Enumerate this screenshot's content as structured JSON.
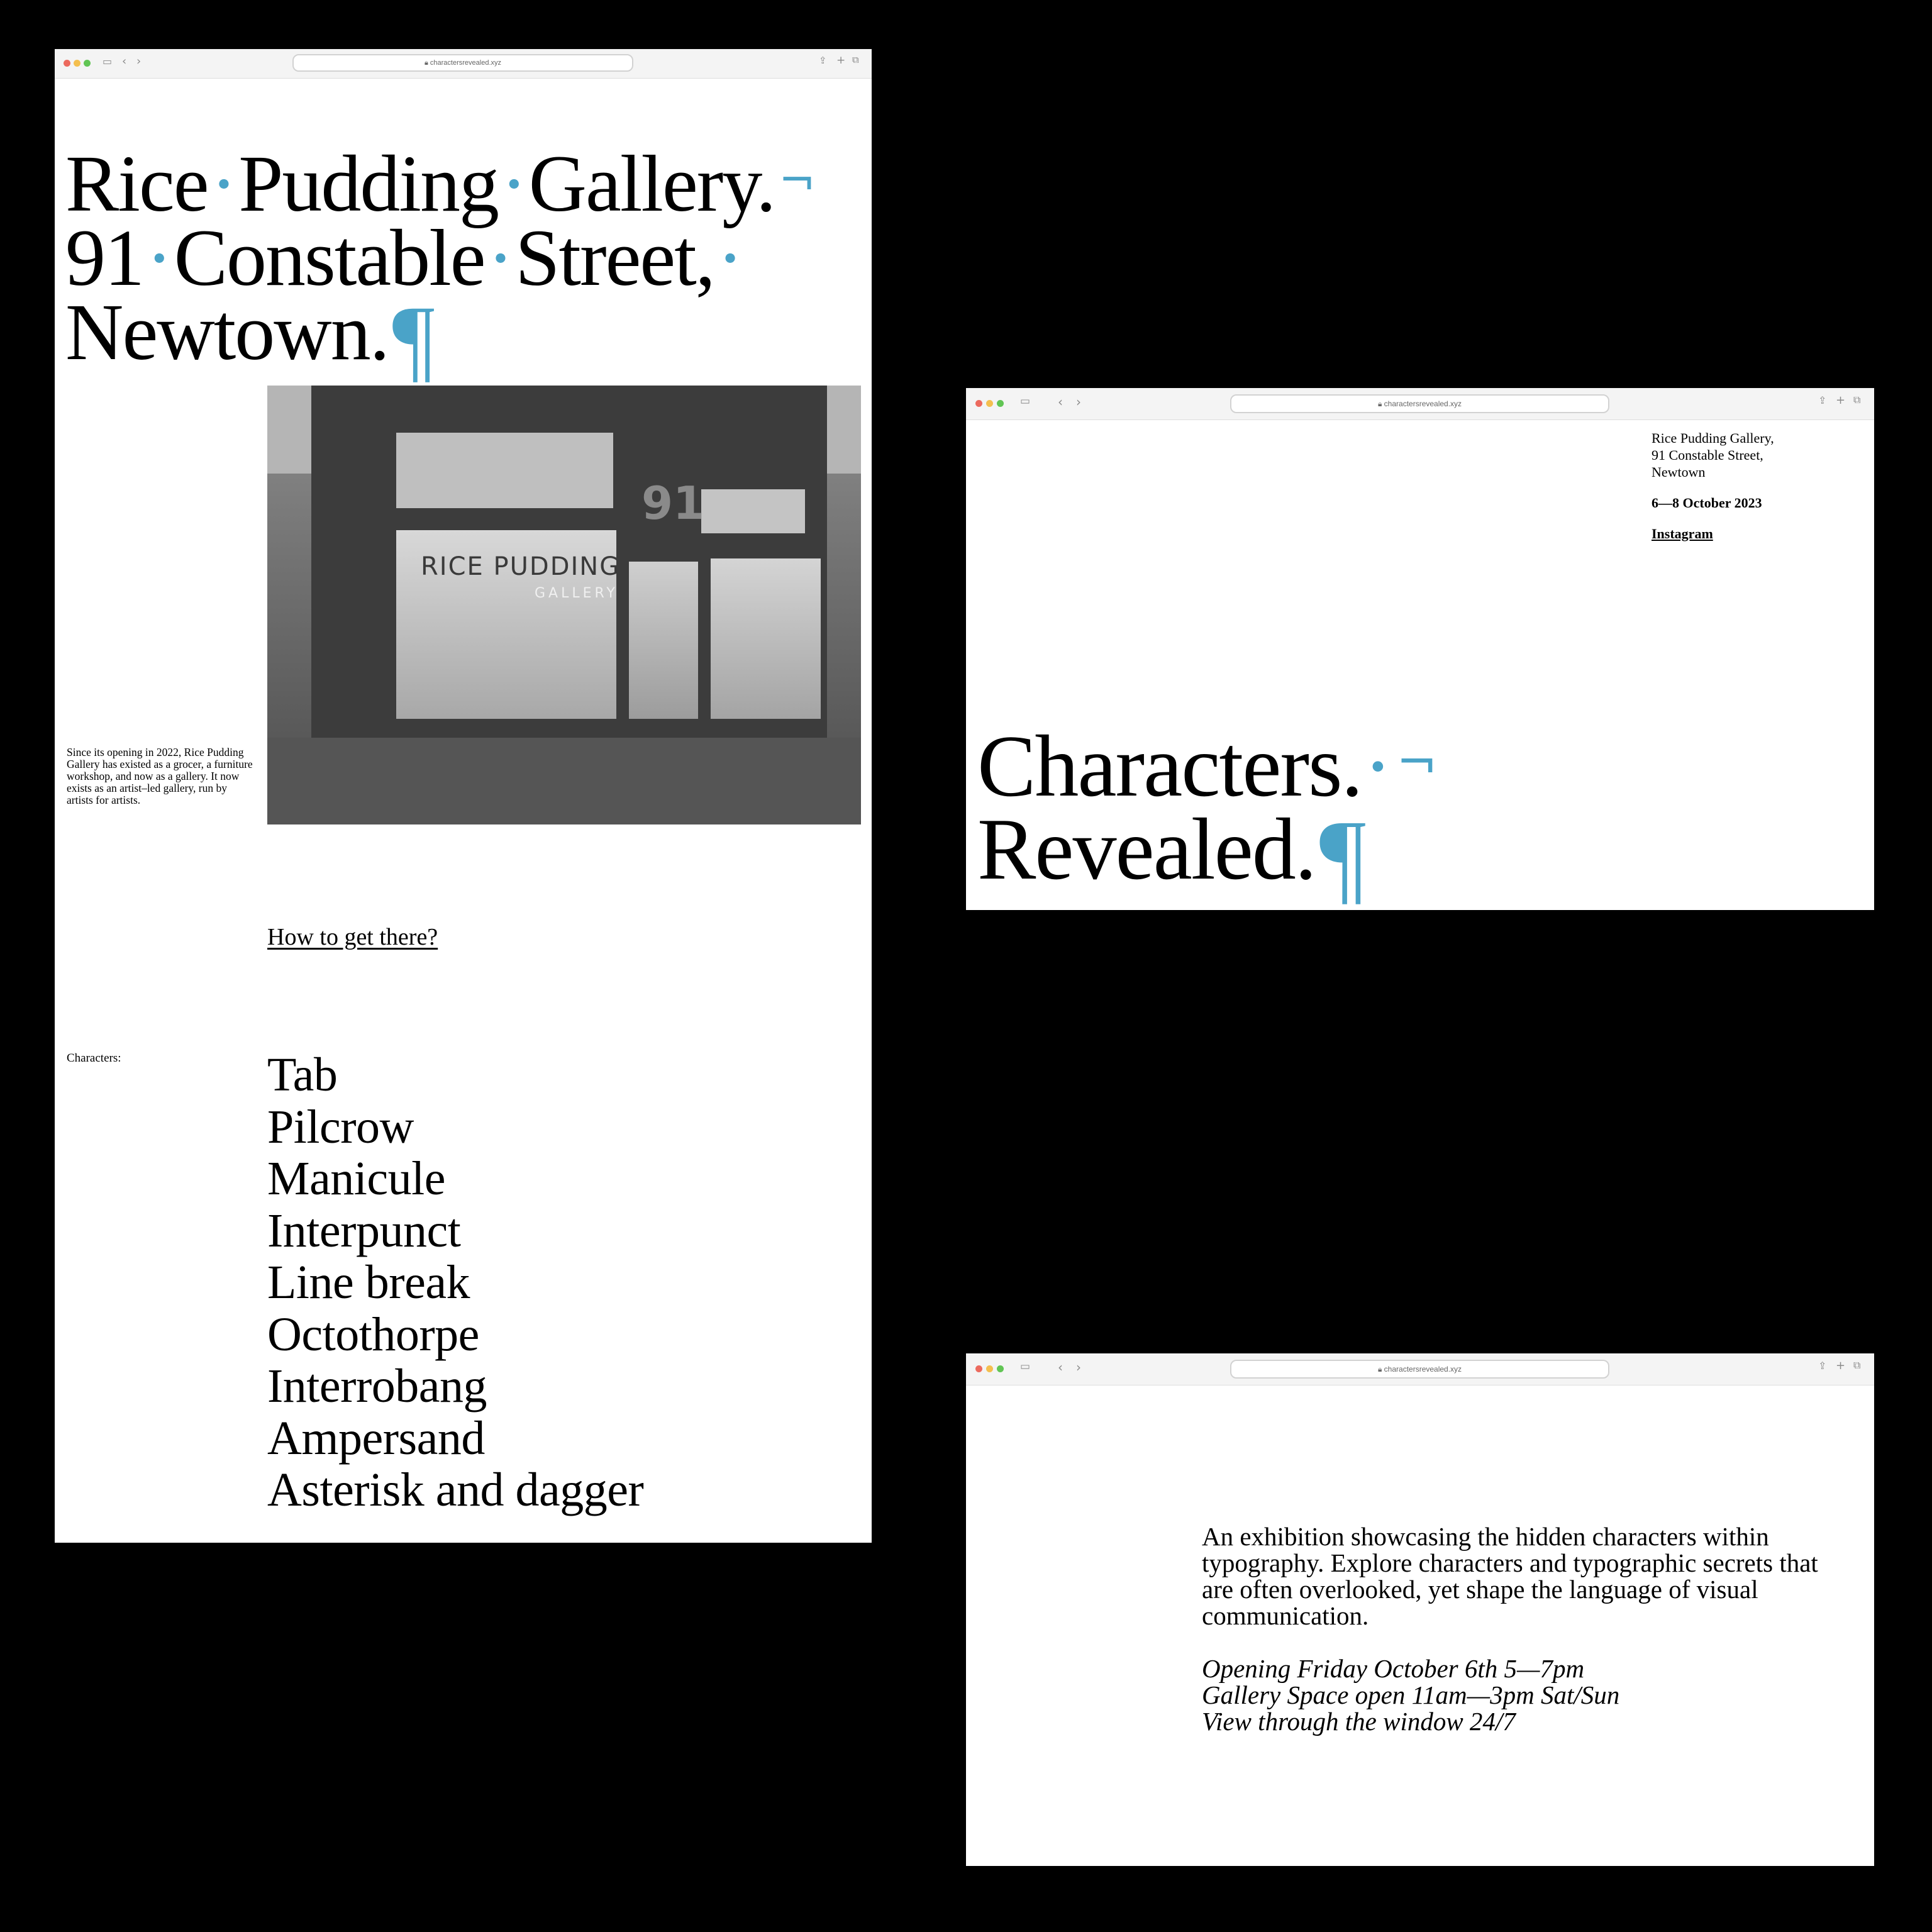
{
  "browser": {
    "url": "charactersrevealed.xyz"
  },
  "page1": {
    "title_lines": [
      [
        "Rice",
        "Pudding",
        "Gallery."
      ],
      [
        "91",
        "Constable",
        "Street,"
      ],
      [
        "Newtown."
      ]
    ],
    "interpunct": "·",
    "line_break_glyph": "¬",
    "pilcrow": "¶",
    "intro": "Since its opening in 2022, Rice Pudding Gallery has existed as a grocer, a furniture workshop, and now as a gallery. It now exists as an artist–led gallery, run by artists for artists.",
    "photo": {
      "sign": "RICE PUDDING",
      "sign_sub": "GALLERY",
      "number": "91"
    },
    "how_link": "How to get there?",
    "characters_label": "Characters:",
    "characters": [
      "Tab",
      "Pilcrow",
      "Manicule",
      "Interpunct",
      "Line break",
      "Octothorpe",
      "Interrobang",
      "Ampersand",
      "Asterisk and dagger"
    ]
  },
  "page2": {
    "address": [
      "Rice Pudding Gallery,",
      "91 Constable Street,",
      "Newtown"
    ],
    "dates": "6—8 October 2023",
    "instagram": "Instagram",
    "title_lines": [
      "Characters.",
      "Revealed."
    ]
  },
  "page3": {
    "description": "An exhibition showcasing the hidden characters within typography. Explore characters and typographic secrets that are often overlooked, yet shape the language of visual communication.",
    "hours": [
      "Opening Friday October 6th 5—7pm",
      "Gallery Space open 11am—3pm Sat/Sun",
      "View through the window 24/7"
    ]
  },
  "colors": {
    "accent": "#4aa3c8",
    "background": "#000000",
    "page": "#ffffff"
  },
  "icons": [
    "sidebar-icon",
    "back-icon",
    "forward-icon",
    "lock-icon",
    "share-icon",
    "new-tab-icon",
    "tabs-icon"
  ]
}
